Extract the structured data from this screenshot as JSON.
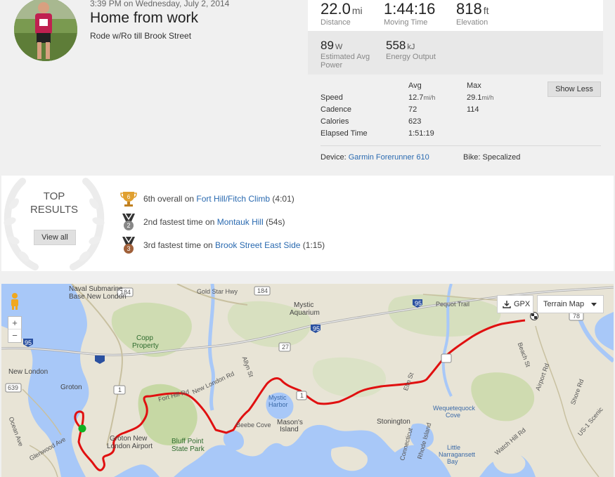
{
  "activity": {
    "datetime": "3:39 PM on Wednesday, July 2, 2014",
    "title": "Home from work",
    "description": "Rode w/Ro till Brook Street"
  },
  "stats": {
    "distance": {
      "value": "22.0",
      "unit": "mi",
      "label": "Distance"
    },
    "moving_time": {
      "value": "1:44:16",
      "label": "Moving Time"
    },
    "elevation": {
      "value": "818",
      "unit": "ft",
      "label": "Elevation"
    },
    "power": {
      "value": "89",
      "unit": "W",
      "label_line1": "Estimated Avg",
      "label_line2": "Power"
    },
    "energy": {
      "value": "558",
      "unit": "kJ",
      "label": "Energy Output"
    }
  },
  "details": {
    "avg_header": "Avg",
    "max_header": "Max",
    "rows": [
      {
        "label": "Speed",
        "avg": "12.7",
        "avg_unit": "mi/h",
        "max": "29.1",
        "max_unit": "mi/h"
      },
      {
        "label": "Cadence",
        "avg": "72",
        "avg_unit": "",
        "max": "114",
        "max_unit": ""
      },
      {
        "label": "Calories",
        "avg": "623",
        "avg_unit": "",
        "max": "",
        "max_unit": ""
      },
      {
        "label": "Elapsed Time",
        "avg": "1:51:19",
        "avg_unit": "",
        "max": "",
        "max_unit": ""
      }
    ],
    "show_less": "Show Less",
    "device_label": "Device: ",
    "device_name": "Garmin Forerunner 610",
    "bike": "Bike: Specalized"
  },
  "results": {
    "heading_line1": "TOP",
    "heading_line2": "RESULTS",
    "view_all": "View all",
    "items": [
      {
        "prefix": "6th overall on ",
        "segment": "Fort Hill/Fitch Climb",
        "suffix": " (4:01)",
        "rank": "6",
        "medal_color": "#e0a030"
      },
      {
        "prefix": "2nd fastest time on ",
        "segment": "Montauk Hill",
        "suffix": " (54s)",
        "rank": "2",
        "medal_color": "#888888"
      },
      {
        "prefix": "3rd fastest time on ",
        "segment": "Brook Street East Side",
        "suffix": " (1:15)",
        "rank": "3",
        "medal_color": "#a0603a"
      }
    ]
  },
  "map": {
    "gpx_button": "GPX",
    "terrain_button": "Terrain Map",
    "zoom_in": "+",
    "zoom_out": "−",
    "route_color": "#e01010",
    "labels": {
      "naval_base_1": "Naval Submarine",
      "naval_base_2": "Base New London",
      "gold_star": "Gold Star Hwy",
      "copp_1": "Copp",
      "copp_2": "Property",
      "new_london": "New London",
      "groton": "Groton",
      "groton_airport_1": "Groton New",
      "groton_airport_2": "London Airport",
      "bluff_1": "Bluff Point",
      "bluff_2": "State Park",
      "mystic_aquarium_1": "Mystic",
      "mystic_aquarium_2": "Aquarium",
      "mystic_harbor_1": "Mystic",
      "mystic_harbor_2": "Harbor",
      "masons_1": "Mason's",
      "masons_2": "Island",
      "stonington": "Stonington",
      "pequot": "Pequot Trail",
      "wequetequock_1": "Wequetequock",
      "wequetequock_2": "Cove",
      "little_narragansett_1": "Little",
      "little_narragansett_2": "Narragansett",
      "little_narragansett_3": "Bay",
      "connecticut": "Connecticut",
      "rhode_island": "Rhode Island",
      "ocean_ave": "Ocean Ave",
      "glenwood": "Glenwood Ave",
      "beebe": "Beebe Cove",
      "new_london_rd": "New London Rd",
      "fort_hill": "Fort Hill Rd",
      "allyn": "Allyn St",
      "elm": "Elm St",
      "airport_rd": "Airport Rd",
      "beach_st": "Beach St",
      "us1": "US-1 Scenic",
      "shore_rd": "Shore Rd",
      "watch_hill": "Watch Hill Rd",
      "route_184a": "184",
      "route_184b": "184",
      "route_95a": "95",
      "route_95b": "95",
      "route_95c": "95",
      "route_27": "27",
      "route_1": "1",
      "route_639": "639",
      "route_78": "78",
      "route_1b": "1"
    }
  }
}
